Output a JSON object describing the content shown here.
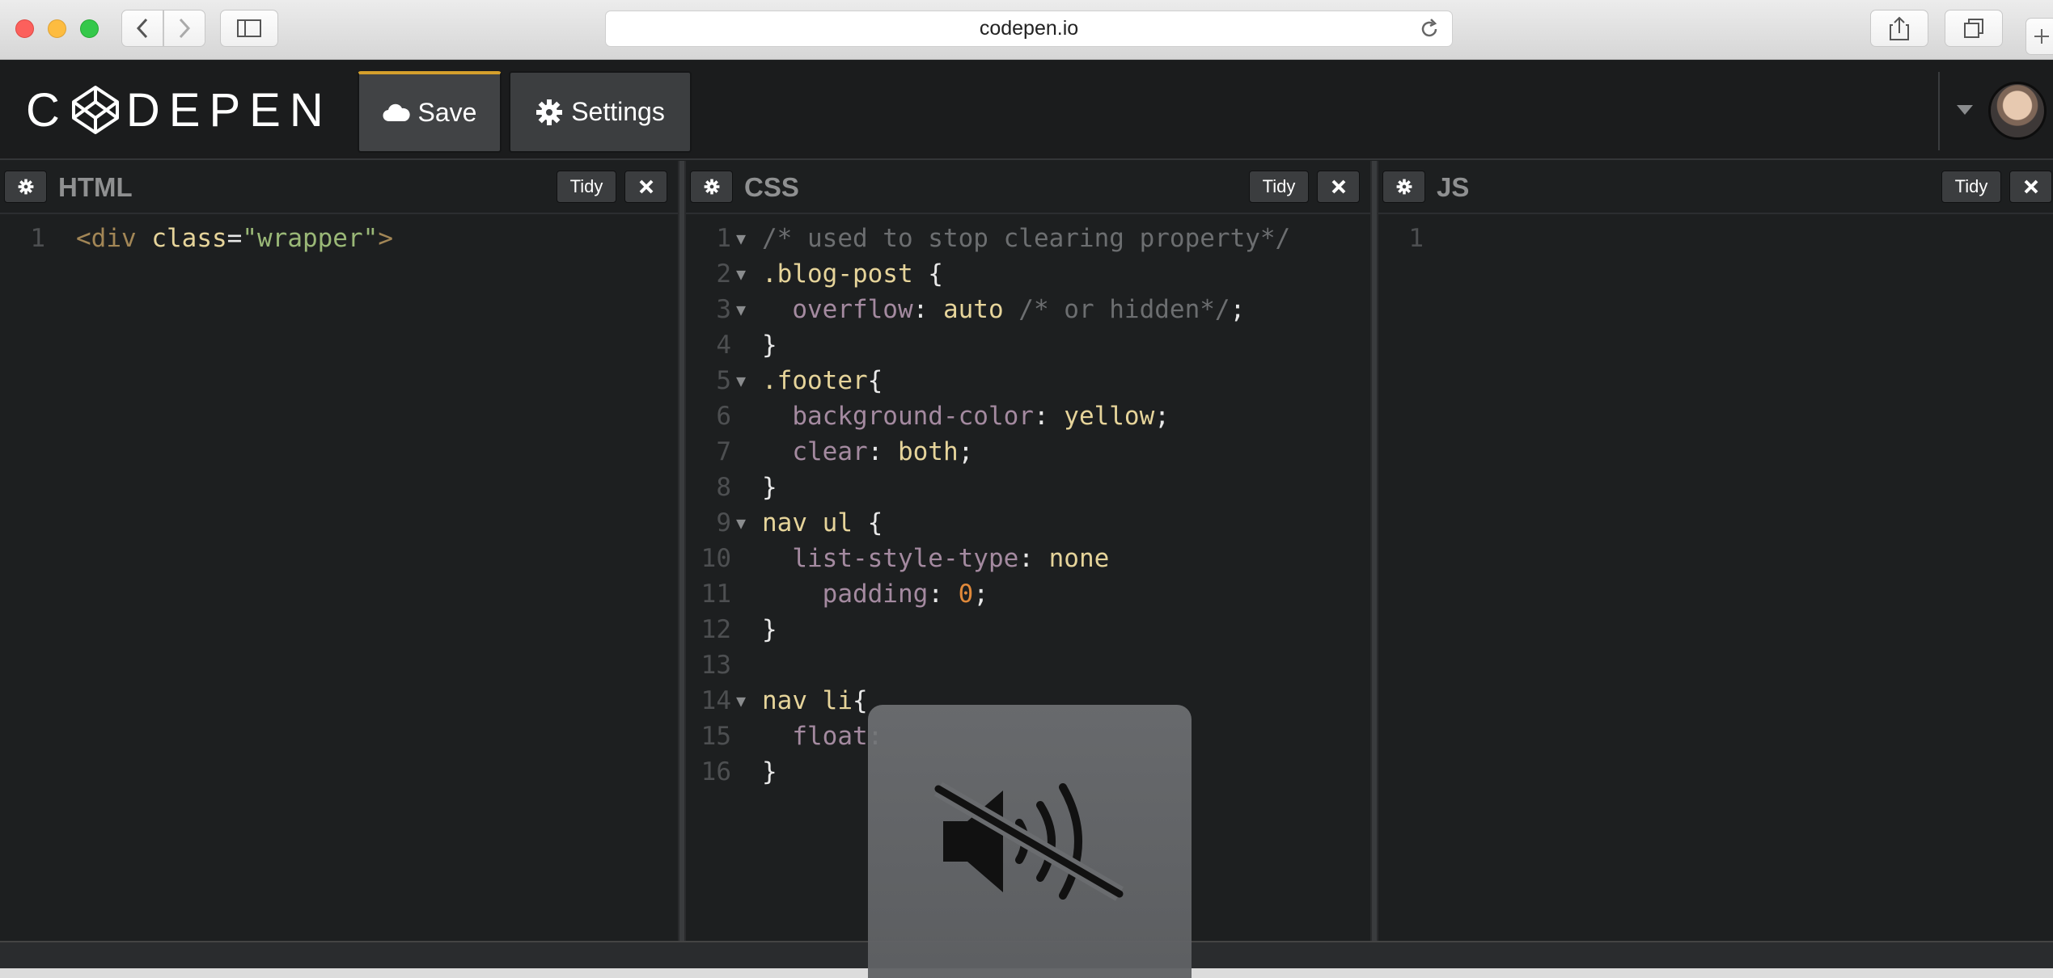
{
  "browser": {
    "url": "codepen.io"
  },
  "header": {
    "logo_text": "C DEPEN",
    "save_label": "Save",
    "settings_label": "Settings"
  },
  "panes": [
    {
      "title": "HTML",
      "tidy": "Tidy"
    },
    {
      "title": "CSS",
      "tidy": "Tidy"
    },
    {
      "title": "JS",
      "tidy": "Tidy"
    }
  ],
  "html_code": [
    {
      "n": "1",
      "t": "<div class=\"wrapper\">"
    }
  ],
  "css_code": [
    {
      "n": "1",
      "t": "/* used to stop clearing property*/"
    },
    {
      "n": "2",
      "t": ".blog-post {"
    },
    {
      "n": "3",
      "t": "  overflow: auto /* or hidden*/;"
    },
    {
      "n": "4",
      "t": "}"
    },
    {
      "n": "5",
      "t": ".footer{"
    },
    {
      "n": "6",
      "t": "  background-color: yellow;"
    },
    {
      "n": "7",
      "t": "  clear: both;"
    },
    {
      "n": "8",
      "t": "}"
    },
    {
      "n": "9",
      "t": "nav ul {"
    },
    {
      "n": "10",
      "t": "  list-style-type: none"
    },
    {
      "n": "11",
      "t": "    padding: 0;"
    },
    {
      "n": "12",
      "t": "}"
    },
    {
      "n": "13",
      "t": ""
    },
    {
      "n": "14",
      "t": "nav li{"
    },
    {
      "n": "15",
      "t": "  float:"
    },
    {
      "n": "16",
      "t": "}"
    }
  ],
  "js_code": [
    {
      "n": "1",
      "t": ""
    }
  ],
  "overlay": {
    "icon": "speaker-muted-icon"
  },
  "colors": {
    "accent": "#d5a02c",
    "background": "#1d1f20"
  }
}
